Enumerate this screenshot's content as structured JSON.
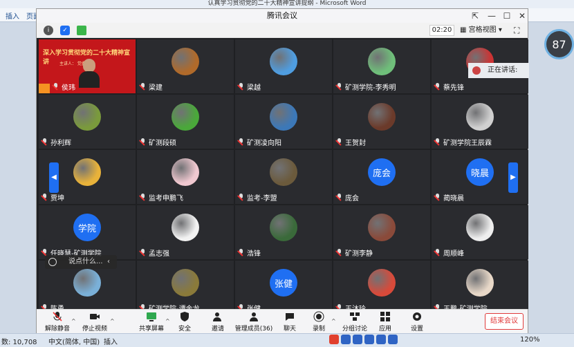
{
  "word": {
    "title": "认真学习贯彻党的二十大精神宣讲提纲 - Microsoft Word",
    "ribbon_insert": "插入",
    "ribbon_page": "页面",
    "status_wordcount": "数: 10,708",
    "status_lang": "中文(简体, 中国)",
    "status_mode": "插入",
    "status_zoom": "120%",
    "zoom_widget": "87"
  },
  "meeting": {
    "window_title": "腾讯会议",
    "timer": "02:20",
    "view_mode": "宫格视图",
    "speaking_label": "正在讲话:",
    "chat_placeholder": "说点什么...",
    "tiles": [
      {
        "name": "侯玮",
        "banner": "深入学习贯彻党的二十大精神宣讲",
        "banner_sub": "主讲人：             党委书记",
        "avatar_color": "#8b1a1a"
      },
      {
        "name": "梁建",
        "avatar_color": "#b06a2a"
      },
      {
        "name": "梁越",
        "avatar_color": "#4f9de0"
      },
      {
        "name": "矿测学院-李秀明",
        "avatar_color": "#6fbf7a"
      },
      {
        "name": "蔡先锋",
        "avatar_color": "#cc3333"
      },
      {
        "name": "孙利辉",
        "avatar_color": "#7a9a3c"
      },
      {
        "name": "矿测段硕",
        "avatar_color": "#4aa83a"
      },
      {
        "name": "矿测凌向阳",
        "avatar_color": "#3c78b8"
      },
      {
        "name": "王贺封",
        "avatar_color": "#6b3a2a"
      },
      {
        "name": "矿测学院王辰霖",
        "avatar_color": "#d0d0d0"
      },
      {
        "name": "贾坤",
        "avatar_color": "#e8b23a"
      },
      {
        "name": "监考申鹏飞",
        "avatar_color": "#f0c8d0"
      },
      {
        "name": "监考-李盟",
        "avatar_color": "#6b5a3c"
      },
      {
        "name": "庞会",
        "avatar_text": "庞会"
      },
      {
        "name": "蔺晓晨",
        "avatar_text": "晓晨"
      },
      {
        "name": "任晓慧-矿测学院",
        "avatar_text": "学院"
      },
      {
        "name": "孟志强",
        "avatar_color": "#f2f2f2"
      },
      {
        "name": "浩锋",
        "avatar_color": "#3a6a3a"
      },
      {
        "name": "矿测李静",
        "avatar_color": "#8a4a3a"
      },
      {
        "name": "周顺峰",
        "avatar_color": "#eeeeee"
      },
      {
        "name": "陈勇",
        "avatar_color": "#7ab0d8"
      },
      {
        "name": "矿测学院-谭金龙",
        "avatar_color": "#8a7a3a"
      },
      {
        "name": "张健",
        "avatar_text": "张健"
      },
      {
        "name": "王沐玲",
        "avatar_color": "#d84a3a"
      },
      {
        "name": "王鹏-矿测学院",
        "avatar_color": "#e8d8c8"
      }
    ],
    "toolbar": {
      "mute": "解除静音",
      "video": "停止视频",
      "share": "共享屏幕",
      "security": "安全",
      "invite": "邀请",
      "members": "管理成员(36)",
      "chat": "聊天",
      "record": "录制",
      "breakout": "分组讨论",
      "apps": "应用",
      "settings": "设置",
      "end": "结束会议"
    }
  }
}
